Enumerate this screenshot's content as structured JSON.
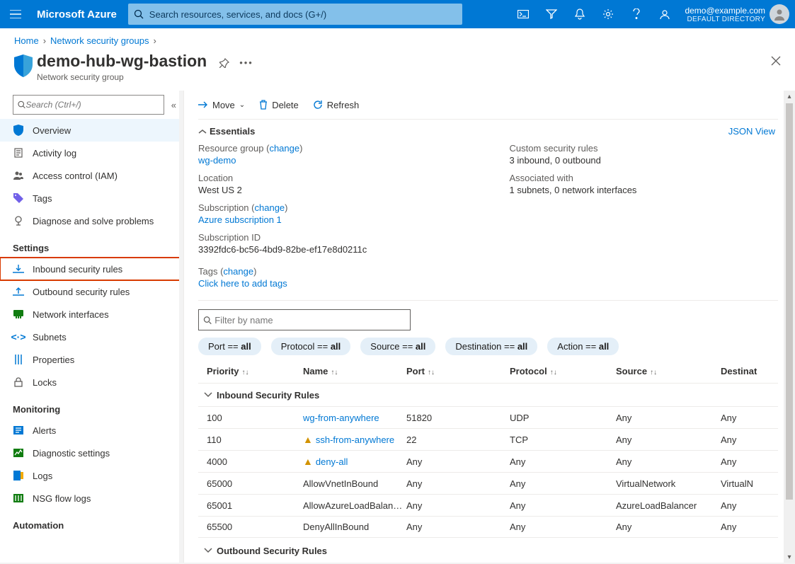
{
  "brand": "Microsoft Azure",
  "search_placeholder": "Search resources, services, and docs (G+/)",
  "account": {
    "email": "demo@example.com",
    "tenant": "DEFAULT DIRECTORY"
  },
  "breadcrumb": {
    "home": "Home",
    "parent": "Network security groups"
  },
  "resource": {
    "name": "demo-hub-wg-bastion",
    "type": "Network security group"
  },
  "nav": {
    "search_placeholder": "Search (Ctrl+/)",
    "items": {
      "overview": "Overview",
      "activity_log": "Activity log",
      "access_control": "Access control (IAM)",
      "tags": "Tags",
      "diagnose": "Diagnose and solve problems",
      "settings_header": "Settings",
      "inbound": "Inbound security rules",
      "outbound": "Outbound security rules",
      "nics": "Network interfaces",
      "subnets": "Subnets",
      "properties": "Properties",
      "locks": "Locks",
      "monitoring_header": "Monitoring",
      "alerts": "Alerts",
      "diag_settings": "Diagnostic settings",
      "logs": "Logs",
      "flow_logs": "NSG flow logs",
      "automation_header": "Automation"
    }
  },
  "commands": {
    "move": "Move",
    "delete": "Delete",
    "refresh": "Refresh"
  },
  "essentials": {
    "title": "Essentials",
    "json_view": "JSON View",
    "rg_label": "Resource group",
    "change": "change",
    "rg_value": "wg-demo",
    "loc_label": "Location",
    "loc_value": "West US 2",
    "sub_label": "Subscription",
    "sub_value": "Azure subscription 1",
    "subid_label": "Subscription ID",
    "subid_value": "3392fdc6-bc56-4bd9-82be-ef17e8d0211c",
    "tags_label": "Tags",
    "tags_value": "Click here to add tags",
    "custom_label": "Custom security rules",
    "custom_value": "3 inbound, 0 outbound",
    "assoc_label": "Associated with",
    "assoc_value": "1 subnets, 0 network interfaces"
  },
  "filter_placeholder": "Filter by name",
  "pills": {
    "port": "Port == ",
    "protocol": "Protocol == ",
    "source": "Source == ",
    "destination": "Destination == ",
    "action": "Action == ",
    "all": "all"
  },
  "columns": {
    "priority": "Priority",
    "name": "Name",
    "port": "Port",
    "protocol": "Protocol",
    "source": "Source",
    "destination": "Destinat"
  },
  "sections": {
    "inbound": "Inbound Security Rules",
    "outbound": "Outbound Security Rules"
  },
  "rules_inbound": [
    {
      "priority": "100",
      "name": "wg-from-anywhere",
      "warn": false,
      "link": true,
      "port": "51820",
      "protocol": "UDP",
      "source": "Any",
      "dest": "Any"
    },
    {
      "priority": "110",
      "name": "ssh-from-anywhere",
      "warn": true,
      "link": true,
      "port": "22",
      "protocol": "TCP",
      "source": "Any",
      "dest": "Any"
    },
    {
      "priority": "4000",
      "name": "deny-all",
      "warn": true,
      "link": true,
      "port": "Any",
      "protocol": "Any",
      "source": "Any",
      "dest": "Any"
    },
    {
      "priority": "65000",
      "name": "AllowVnetInBound",
      "warn": false,
      "link": false,
      "port": "Any",
      "protocol": "Any",
      "source": "VirtualNetwork",
      "dest": "VirtualN"
    },
    {
      "priority": "65001",
      "name": "AllowAzureLoadBalan…",
      "warn": false,
      "link": false,
      "port": "Any",
      "protocol": "Any",
      "source": "AzureLoadBalancer",
      "dest": "Any"
    },
    {
      "priority": "65500",
      "name": "DenyAllInBound",
      "warn": false,
      "link": false,
      "port": "Any",
      "protocol": "Any",
      "source": "Any",
      "dest": "Any"
    }
  ]
}
